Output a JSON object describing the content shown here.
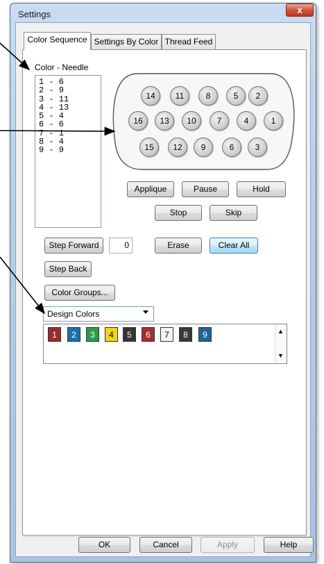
{
  "window": {
    "title": "Settings",
    "close_glyph": "x"
  },
  "tabs": [
    {
      "label": "Color Sequence",
      "active": true
    },
    {
      "label": "Settings By Color",
      "active": false
    },
    {
      "label": "Thread Feed",
      "active": false
    }
  ],
  "needle_list": {
    "label": "Color - Needle",
    "items": [
      "1 - 6",
      "2 - 9",
      "3 - 11",
      "4 - 13",
      "5 - 4",
      "6 - 6",
      "7 - 1",
      "8 - 4",
      "9 - 9"
    ]
  },
  "needle_head": {
    "rows": [
      [
        "14",
        "11",
        "8",
        "5",
        "2"
      ],
      [
        "16",
        "13",
        "10",
        "7",
        "4",
        "1"
      ],
      [
        "15",
        "12",
        "9",
        "6",
        "3"
      ]
    ]
  },
  "actions": {
    "applique": "Applique",
    "pause": "Pause",
    "hold": "Hold",
    "stop": "Stop",
    "skip": "Skip",
    "step_forward": "Step Forward",
    "step_value": "0",
    "erase": "Erase",
    "clear_all": "Clear All",
    "step_back": "Step Back",
    "color_groups": "Color Groups..."
  },
  "palette": {
    "selected": "Design Colors",
    "swatches": [
      {
        "label": "1",
        "color": "#9b2b2a",
        "text_color": "#ffffff"
      },
      {
        "label": "2",
        "color": "#1f6fa8",
        "text_color": "#ffffff"
      },
      {
        "label": "3",
        "color": "#2b9a47",
        "text_color": "#ffffff"
      },
      {
        "label": "4",
        "color": "#f3d21e",
        "text_color": "#000000"
      },
      {
        "label": "5",
        "color": "#3a3434",
        "text_color": "#ffffff"
      },
      {
        "label": "6",
        "color": "#a3302d",
        "text_color": "#ffffff"
      },
      {
        "label": "7",
        "color": "#f4f4fb",
        "text_color": "#000000"
      },
      {
        "label": "8",
        "color": "#3b3838",
        "text_color": "#ffffff"
      },
      {
        "label": "9",
        "color": "#1e6496",
        "text_color": "#ffffff"
      }
    ]
  },
  "dialog_buttons": {
    "ok": "OK",
    "cancel": "Cancel",
    "apply": "Apply",
    "help": "Help"
  }
}
